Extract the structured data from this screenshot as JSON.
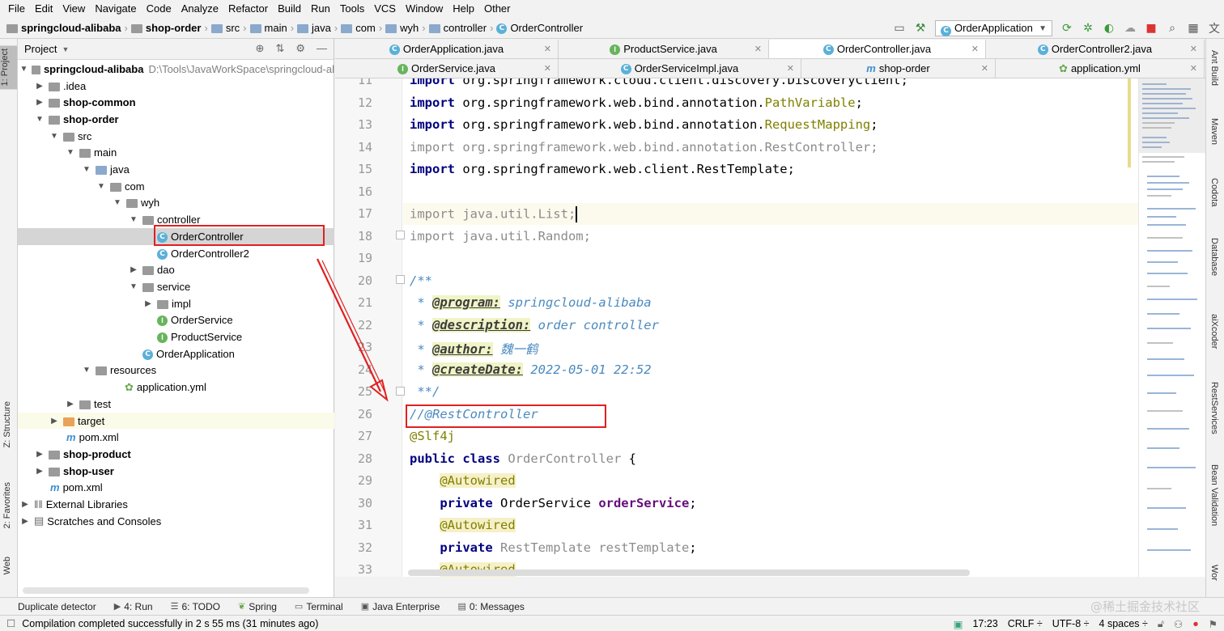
{
  "menu": [
    "File",
    "Edit",
    "View",
    "Navigate",
    "Code",
    "Analyze",
    "Refactor",
    "Build",
    "Run",
    "Tools",
    "VCS",
    "Window",
    "Help",
    "Other"
  ],
  "breadcrumb": [
    "springcloud-alibaba",
    "shop-order",
    "src",
    "main",
    "java",
    "com",
    "wyh",
    "controller",
    "OrderController"
  ],
  "run_config": "OrderApplication",
  "project_panel": {
    "title": "Project",
    "root_path": "D:\\Tools\\JavaWorkSpace\\springcloud-al",
    "tree": [
      "springcloud-alibaba",
      ".idea",
      "shop-common",
      "shop-order",
      "src",
      "main",
      "java",
      "com",
      "wyh",
      "controller",
      "OrderController",
      "OrderController2",
      "dao",
      "service",
      "impl",
      "OrderService",
      "ProductService",
      "OrderApplication",
      "resources",
      "application.yml",
      "test",
      "target",
      "pom.xml",
      "shop-product",
      "shop-user",
      "pom.xml",
      "External Libraries",
      "Scratches and Consoles"
    ]
  },
  "tabs_row1": [
    "OrderApplication.java",
    "ProductService.java",
    "OrderController.java",
    "OrderController2.java"
  ],
  "tabs_row2": [
    "OrderService.java",
    "OrderServiceImpl.java",
    "shop-order",
    "application.yml"
  ],
  "editor": {
    "line_numbers": [
      "11",
      "12",
      "13",
      "14",
      "15",
      "16",
      "17",
      "18",
      "19",
      "20",
      "21",
      "22",
      "23",
      "24",
      "25",
      "26",
      "27",
      "28",
      "29",
      "30",
      "31",
      "32",
      "33"
    ],
    "lines": {
      "l11_kw": "import",
      "l11_rest": " org.springframework.cloud.client.discovery.DiscoveryClient;",
      "l12_kw": "import",
      "l12_pkg": " org.springframework.web.bind.annotation.",
      "l12_cls": "PathVariable",
      "l12_end": ";",
      "l13_kw": "import",
      "l13_pkg": " org.springframework.web.bind.annotation.",
      "l13_cls": "RequestMapping",
      "l13_end": ";",
      "l14": "import org.springframework.web.bind.annotation.RestController;",
      "l15_kw": "import",
      "l15_rest": " org.springframework.web.client.RestTemplate;",
      "l17": "import java.util.List;",
      "l18": "import java.util.Random;",
      "l20": "/**",
      "l21_tag": "@program:",
      "l21_text": " springcloud-alibaba",
      "l22_tag": "@description:",
      "l22_text": " order controller",
      "l23_tag": "@author:",
      "l23_text": " 魏一鹤",
      "l24_tag": "@createDate:",
      "l24_text": " 2022-05-01 22:52",
      "l25": " **/",
      "l26": "//@RestController",
      "l27": "@Slf4j",
      "l28_kw1": "public",
      "l28_kw2": "class",
      "l28_name": " OrderController",
      "l28_end": " {",
      "l29": "@Autowired",
      "l30_kw": "private",
      "l30_type": " OrderService ",
      "l30_field": "orderService",
      "l30_end": ";",
      "l31": "@Autowired",
      "l32_kw": "private",
      "l32_type": " RestTemplate ",
      "l32_field": "restTemplate",
      "l32_end": ";",
      "l33": "@Autowired"
    }
  },
  "right_tools": [
    "Ant Build",
    "Maven",
    "Codota",
    "Database",
    "aiXcoder",
    "RestServices",
    "Bean Validation",
    "Wor"
  ],
  "left_tools": [
    "1: Project",
    "Z: Structure",
    "2: Favorites",
    "Web"
  ],
  "bottom_tools": [
    "Duplicate detector",
    "4: Run",
    "6: TODO",
    "Spring",
    "Terminal",
    "Java Enterprise",
    "0: Messages"
  ],
  "status": {
    "message": "Compilation completed successfully in 2 s 55 ms (31 minutes ago)",
    "position": "17:23",
    "line_sep": "CRLF",
    "encoding": "UTF-8",
    "indent": "4 spaces",
    "event_log": "Event Log"
  },
  "watermark": "@稀土掘金技术社区",
  "colors": {
    "annotation_red": "#e02020",
    "keyword": "#000080",
    "annotation": "#808000",
    "doc_comment": "#4a8abf"
  }
}
